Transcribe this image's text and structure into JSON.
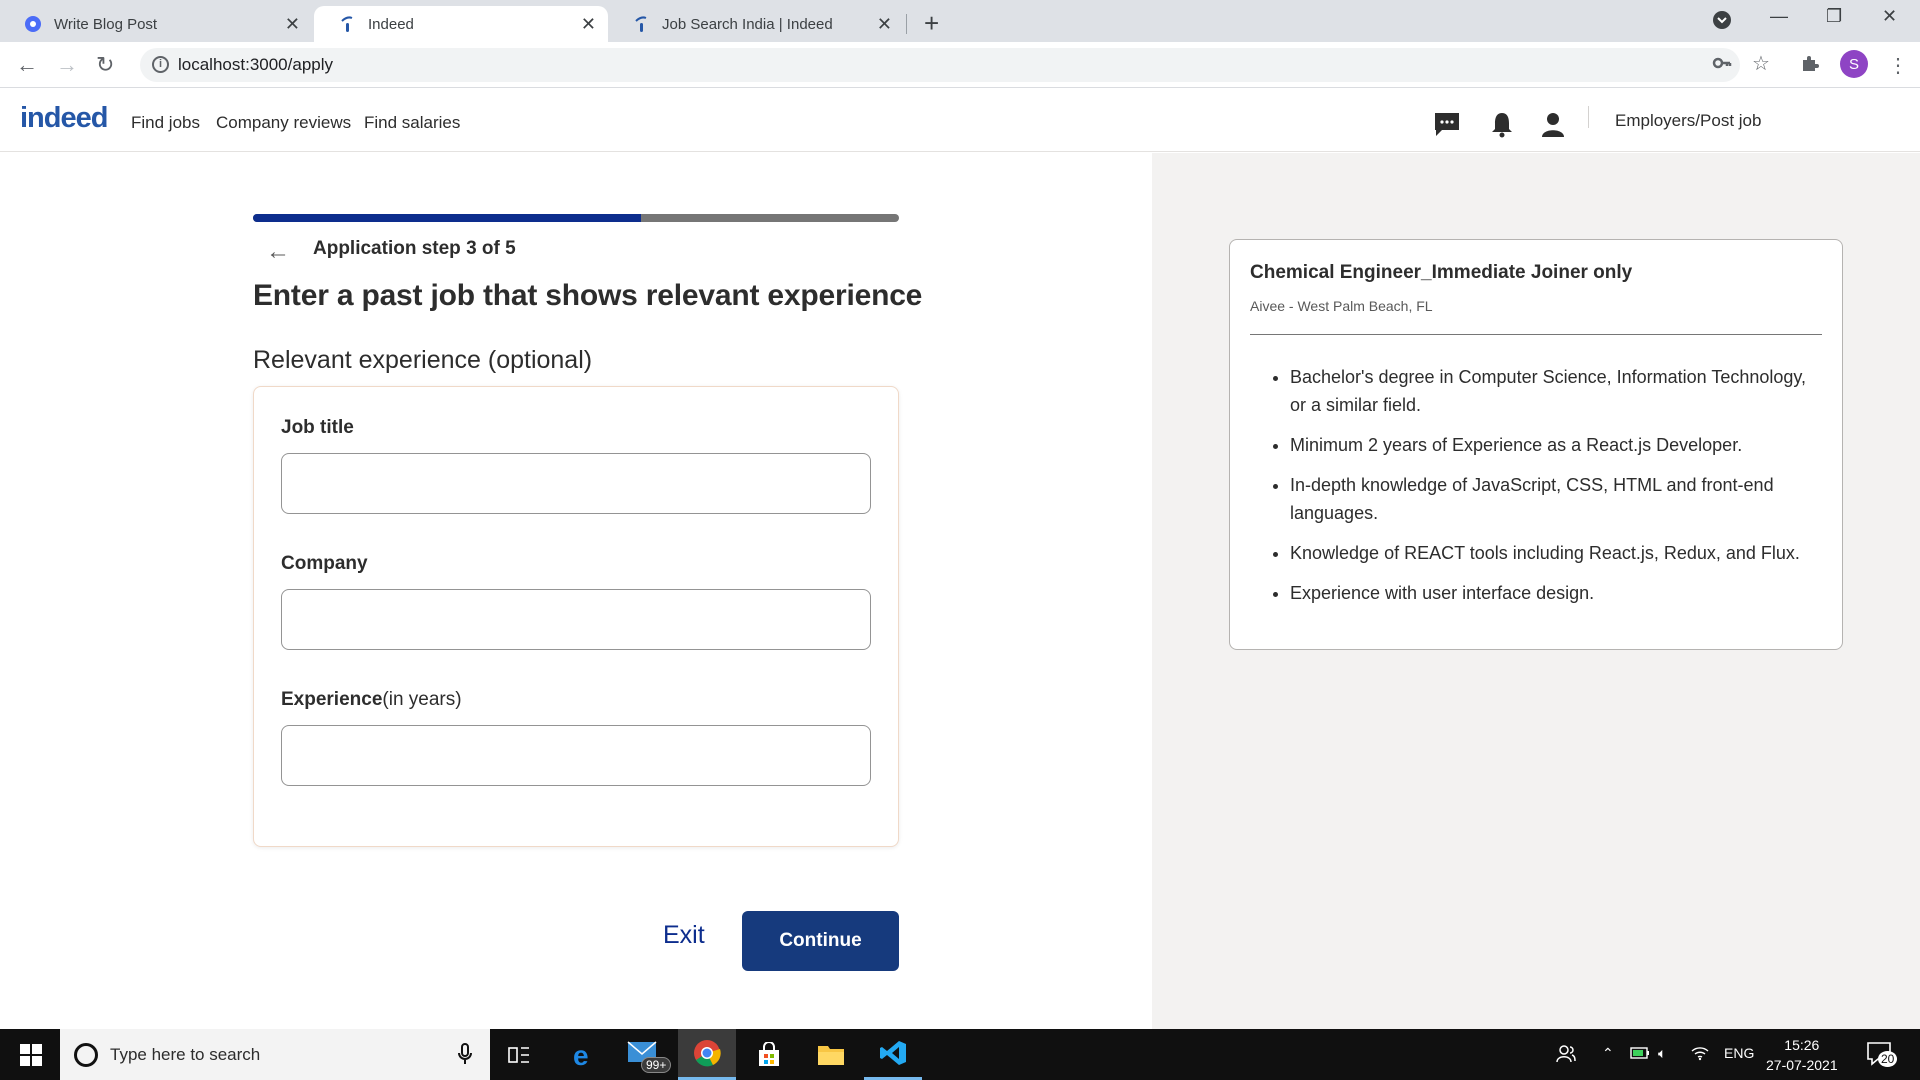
{
  "browser": {
    "tabs": [
      {
        "title": "Write Blog Post"
      },
      {
        "title": "Indeed"
      },
      {
        "title": "Job Search India | Indeed"
      }
    ],
    "url": "localhost:3000/apply",
    "profile_initial": "S"
  },
  "header": {
    "logo": "indeed",
    "nav": [
      "Find jobs",
      "Company reviews",
      "Find salaries"
    ],
    "employers_link": "Employers/Post job"
  },
  "application": {
    "progress_fraction": 0.6,
    "step_text": "Application step 3 of 5",
    "heading": "Enter a past job that shows relevant experience",
    "subheading": "Relevant experience (optional)",
    "fields": {
      "job_title_label": "Job title",
      "job_title_value": "",
      "company_label": "Company",
      "company_value": "",
      "experience_label": "Experience",
      "experience_hint": "(in years)",
      "experience_value": ""
    },
    "exit_label": "Exit",
    "continue_label": "Continue"
  },
  "job": {
    "title": "Chemical Engineer_Immediate Joiner only",
    "company_location": "Aivee - West Palm Beach, FL",
    "requirements": [
      "Bachelor's degree in Computer Science, Information Technology, or a similar field.",
      "Minimum 2 years of Experience as a React.js Developer.",
      "In-depth knowledge of JavaScript, CSS, HTML and front-end languages.",
      "Knowledge of REACT tools including React.js, Redux, and Flux.",
      "Experience with user interface design."
    ]
  },
  "taskbar": {
    "search_placeholder": "Type here to search",
    "mail_badge": "99+",
    "language": "ENG",
    "time": "15:26",
    "date": "27-07-2021",
    "notification_count": "20"
  },
  "colors": {
    "brand": "#2557a7",
    "progress": "#0d2d8d",
    "continue_button": "#163a7d",
    "right_panel_bg": "#f3f2f1"
  }
}
